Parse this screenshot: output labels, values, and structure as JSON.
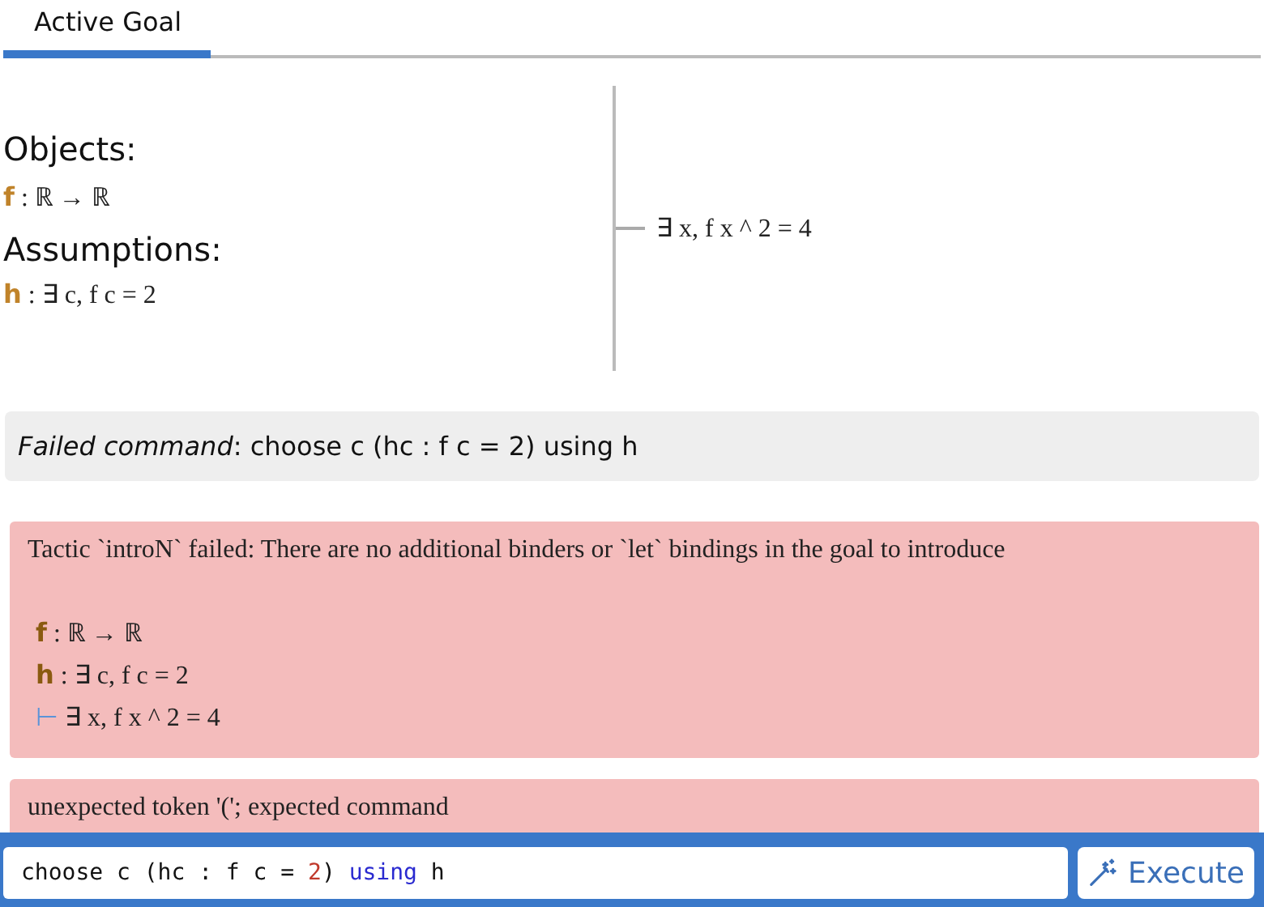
{
  "tabs": [
    {
      "label": "Active Goal",
      "selected": true
    }
  ],
  "separator": ":",
  "goal": {
    "objects_heading": "Objects:",
    "objects": [
      {
        "name": "f",
        "type": "ℝ → ℝ"
      }
    ],
    "assumptions_heading": "Assumptions:",
    "assumptions": [
      {
        "name": "h",
        "type": "∃ c, f c = 2"
      }
    ],
    "target": "∃ x, f x ^ 2 = 4"
  },
  "failed_command": {
    "label": "Failed command",
    "text": ": choose c (hc : f c = 2) using h"
  },
  "errors": [
    {
      "message": "Tactic `introN` failed: There are no additional binders or `let` bindings in the goal to introduce",
      "hypotheses": [
        {
          "name": "f",
          "type": "ℝ → ℝ"
        },
        {
          "name": "h",
          "type": "∃ c, f c = 2"
        }
      ],
      "turnstile": "⊢",
      "target": "∃ x, f x ^ 2 = 4"
    },
    {
      "message": "unexpected token '('; expected command"
    }
  ],
  "command_input": {
    "tokens": [
      {
        "kind": "plain",
        "text": "choose c (hc : f c = "
      },
      {
        "kind": "number",
        "text": "2"
      },
      {
        "kind": "plain",
        "text": ") "
      },
      {
        "kind": "keyword",
        "text": "using"
      },
      {
        "kind": "plain",
        "text": " h"
      }
    ]
  },
  "execute_button": "Execute"
}
